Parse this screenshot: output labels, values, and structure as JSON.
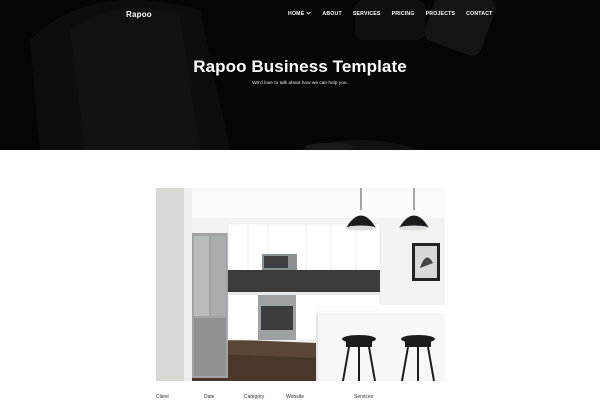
{
  "header": {
    "brand": "Rapoo",
    "nav": [
      {
        "label": "HOME",
        "has_dropdown": true
      },
      {
        "label": "ABOUT"
      },
      {
        "label": "SERVICES"
      },
      {
        "label": "PRICING"
      },
      {
        "label": "PROJECTS"
      },
      {
        "label": "CONTACT"
      }
    ]
  },
  "hero": {
    "title": "Rapoo Business Template",
    "subtitle": "We'd love to talk about how we can help you."
  },
  "project_meta": {
    "labels": [
      "Client",
      "Date",
      "Category",
      "Website",
      "Services"
    ]
  },
  "colors": {
    "hero_bg": "#050505",
    "page_bg": "#ffffff",
    "text_dark": "#333333"
  }
}
